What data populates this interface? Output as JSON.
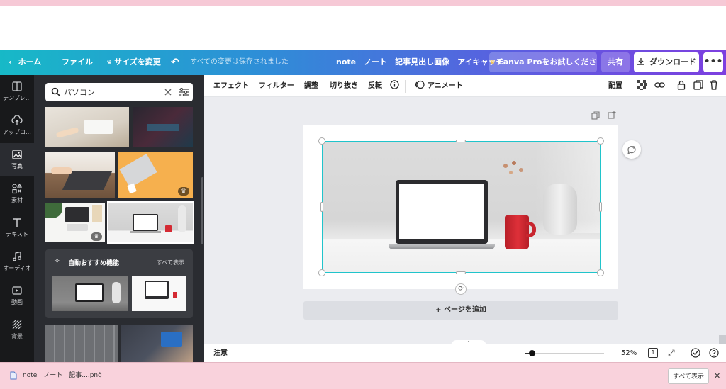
{
  "topbar": {
    "home": "ホーム",
    "file": "ファイル",
    "resize": "サイズを変更",
    "saved_status": "すべての変更は保存されました",
    "doc_title": "note　ノート　記事見出し画像　アイキャッチ",
    "pro_trial": "Canva Proをお試しください",
    "share": "共有",
    "download": "ダウンロード"
  },
  "rail": {
    "items": [
      {
        "label": "テンプレ…",
        "icon": "template-icon"
      },
      {
        "label": "アップロ…",
        "icon": "upload-icon"
      },
      {
        "label": "写真",
        "icon": "photo-icon"
      },
      {
        "label": "素材",
        "icon": "elements-icon"
      },
      {
        "label": "テキスト",
        "icon": "text-icon"
      },
      {
        "label": "オーディオ",
        "icon": "audio-icon"
      },
      {
        "label": "動画",
        "icon": "video-icon"
      },
      {
        "label": "背景",
        "icon": "background-icon"
      }
    ],
    "active_index": 2
  },
  "panel": {
    "search_value": "パソコン",
    "recommend_title": "自動おすすめ機能",
    "show_all": "すべて表示"
  },
  "toolbar": {
    "effect": "エフェクト",
    "filter": "フィルター",
    "adjust": "調整",
    "crop": "切り抜き",
    "flip": "反転",
    "animate": "アニメート",
    "arrange": "配置"
  },
  "canvas": {
    "add_page": "+ ページを追加"
  },
  "status": {
    "notes": "注意",
    "zoom": "52%",
    "page_number": "1"
  },
  "downloads": {
    "file_name": "note　ノート　記事....png",
    "show_all": "すべて表示"
  },
  "colors": {
    "selection": "#20c4cb",
    "mug": "#d42a33",
    "dark_rail": "#18191b",
    "panel_bg": "#2a2c31"
  }
}
